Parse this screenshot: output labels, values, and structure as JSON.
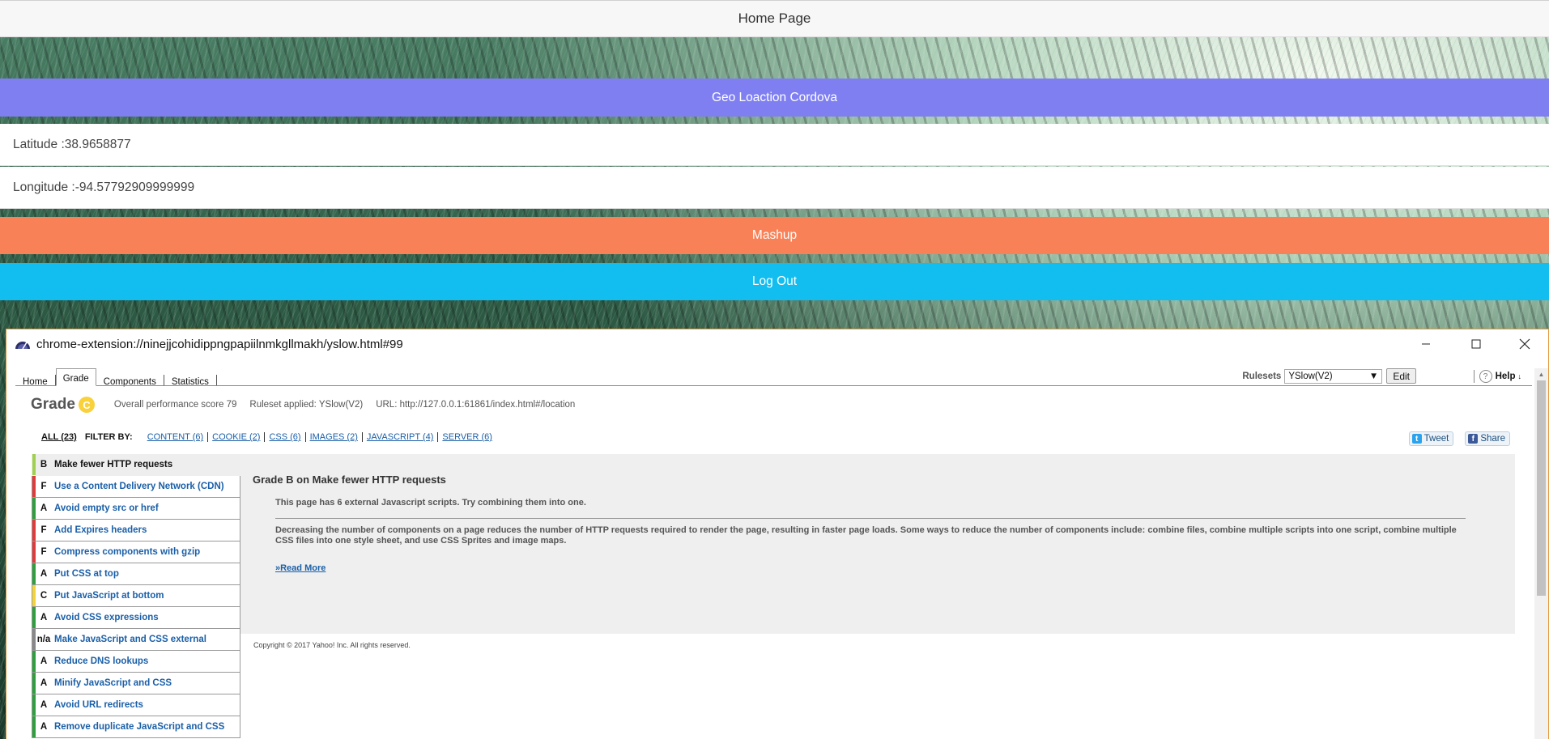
{
  "app": {
    "header_title": "Home Page",
    "geo_button": "Geo Loaction Cordova",
    "latitude": "Latitude :38.9658877",
    "longitude": "Longitude :-94.57792909999999",
    "mashup_button": "Mashup",
    "logout_button": "Log Out"
  },
  "popup": {
    "title": "chrome-extension://ninejjcohidippngpapiilnmkgllmakh/yslow.html#99",
    "tabs": [
      "Home",
      "Grade",
      "Components",
      "Statistics"
    ],
    "active_tab": "Grade",
    "rulesets_label": "Rulesets",
    "ruleset_selected": "YSlow(V2)",
    "edit_label": "Edit",
    "help_label": "Help",
    "grade_word": "Grade",
    "grade_letter": "C",
    "overall_score_text": "Overall performance score 79",
    "ruleset_applied_text": "Ruleset applied: YSlow(V2)",
    "url_text": "URL: http://127.0.0.1:61861/index.html#/location",
    "filters": {
      "all": "ALL (23)",
      "filter_by": "FILTER BY:",
      "links": [
        "CONTENT (6)",
        "COOKIE (2)",
        "CSS (6)",
        "IMAGES (2)",
        "JAVASCRIPT (4)",
        "SERVER (6)"
      ]
    },
    "social": {
      "tweet": "Tweet",
      "share": "Share"
    },
    "rules": [
      {
        "grade": "B",
        "name": "Make fewer HTTP requests",
        "color": "#a0d050"
      },
      {
        "grade": "F",
        "name": "Use a Content Delivery Network (CDN)",
        "color": "#e03a3a"
      },
      {
        "grade": "A",
        "name": "Avoid empty src or href",
        "color": "#2e9e3e"
      },
      {
        "grade": "F",
        "name": "Add Expires headers",
        "color": "#e03a3a"
      },
      {
        "grade": "F",
        "name": "Compress components with gzip",
        "color": "#e03a3a"
      },
      {
        "grade": "A",
        "name": "Put CSS at top",
        "color": "#2e9e3e"
      },
      {
        "grade": "C",
        "name": "Put JavaScript at bottom",
        "color": "#f2d43a"
      },
      {
        "grade": "A",
        "name": "Avoid CSS expressions",
        "color": "#2e9e3e"
      },
      {
        "grade": "n/a",
        "name": "Make JavaScript and CSS external",
        "color": "#888888"
      },
      {
        "grade": "A",
        "name": "Reduce DNS lookups",
        "color": "#2e9e3e"
      },
      {
        "grade": "A",
        "name": "Minify JavaScript and CSS",
        "color": "#2e9e3e"
      },
      {
        "grade": "A",
        "name": "Avoid URL redirects",
        "color": "#2e9e3e"
      },
      {
        "grade": "A",
        "name": "Remove duplicate JavaScript and CSS",
        "color": "#2e9e3e"
      }
    ],
    "detail": {
      "title": "Grade B on Make fewer HTTP requests",
      "message": "This page has 6 external Javascript scripts. Try combining them into one.",
      "description": "Decreasing the number of components on a page reduces the number of HTTP requests required to render the page, resulting in faster page loads. Some ways to reduce the number of components include: combine files, combine multiple scripts into one script, combine multiple CSS files into one style sheet, and use CSS Sprites and image maps.",
      "read_more": "»Read More"
    },
    "copyright": "Copyright © 2017 Yahoo! Inc. All rights reserved."
  }
}
